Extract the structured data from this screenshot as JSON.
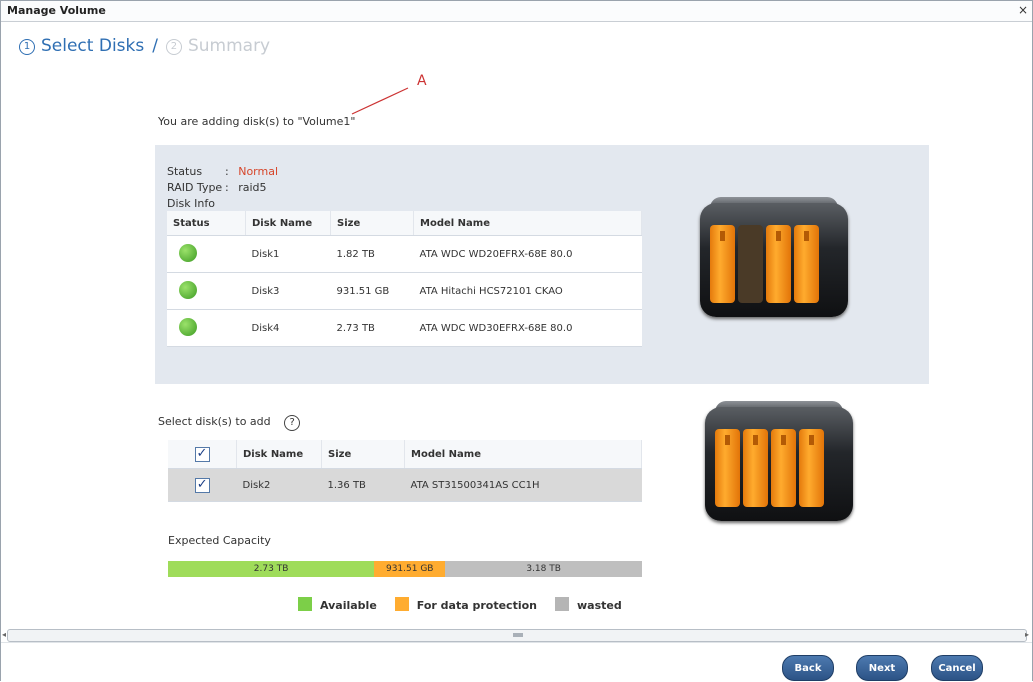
{
  "window": {
    "title": "Manage Volume",
    "close_glyph": "×"
  },
  "steps": [
    {
      "num": "1",
      "label": "Select Disks"
    },
    {
      "num": "2",
      "label": "Summary"
    }
  ],
  "step_separator": "/",
  "annotation_label": "A",
  "adding_text": "You are adding disk(s) to \"Volume1\"",
  "info": {
    "status_label": "Status",
    "status_sep": ":",
    "status_value": "Normal",
    "raid_label": "RAID Type",
    "raid_sep": ":",
    "raid_value": "raid5",
    "diskinfo_label": "Disk Info"
  },
  "disk_table": {
    "headers": [
      "Status",
      "Disk Name",
      "Size",
      "Model Name"
    ],
    "rows": [
      {
        "name": "Disk1",
        "size": "1.82 TB",
        "model": "ATA WDC WD20EFRX-68E 80.0"
      },
      {
        "name": "Disk3",
        "size": "931.51 GB",
        "model": "ATA Hitachi HCS72101 CKAO"
      },
      {
        "name": "Disk4",
        "size": "2.73 TB",
        "model": "ATA WDC WD30EFRX-68E 80.0"
      }
    ]
  },
  "select": {
    "label": "Select disk(s) to add",
    "help_glyph": "?",
    "headers": [
      "Disk Name",
      "Size",
      "Model Name"
    ],
    "rows": [
      {
        "checked": true,
        "name": "Disk2",
        "size": "1.36 TB",
        "model": "ATA ST31500341AS CC1H"
      }
    ]
  },
  "capacity": {
    "label": "Expected Capacity",
    "segments": [
      {
        "text": "2.73 TB",
        "fraction": 0.435,
        "color": "#9fdc5a"
      },
      {
        "text": "931.51 GB",
        "fraction": 0.15,
        "color": "#ffac30"
      },
      {
        "text": "3.18 TB",
        "fraction": 0.415,
        "color": "#bfbfbf"
      }
    ]
  },
  "legend": [
    {
      "label": "Available",
      "color": "#7ccf48"
    },
    {
      "label": "For data protection",
      "color": "#ffac30"
    },
    {
      "label": "wasted",
      "color": "#b5b5b5"
    }
  ],
  "buttons": {
    "back": "Back",
    "next": "Next",
    "cancel": "Cancel"
  },
  "colors": {
    "accent": "#2f6fb3",
    "status_normal": "#d6452a",
    "drive": "#f39a1f"
  }
}
